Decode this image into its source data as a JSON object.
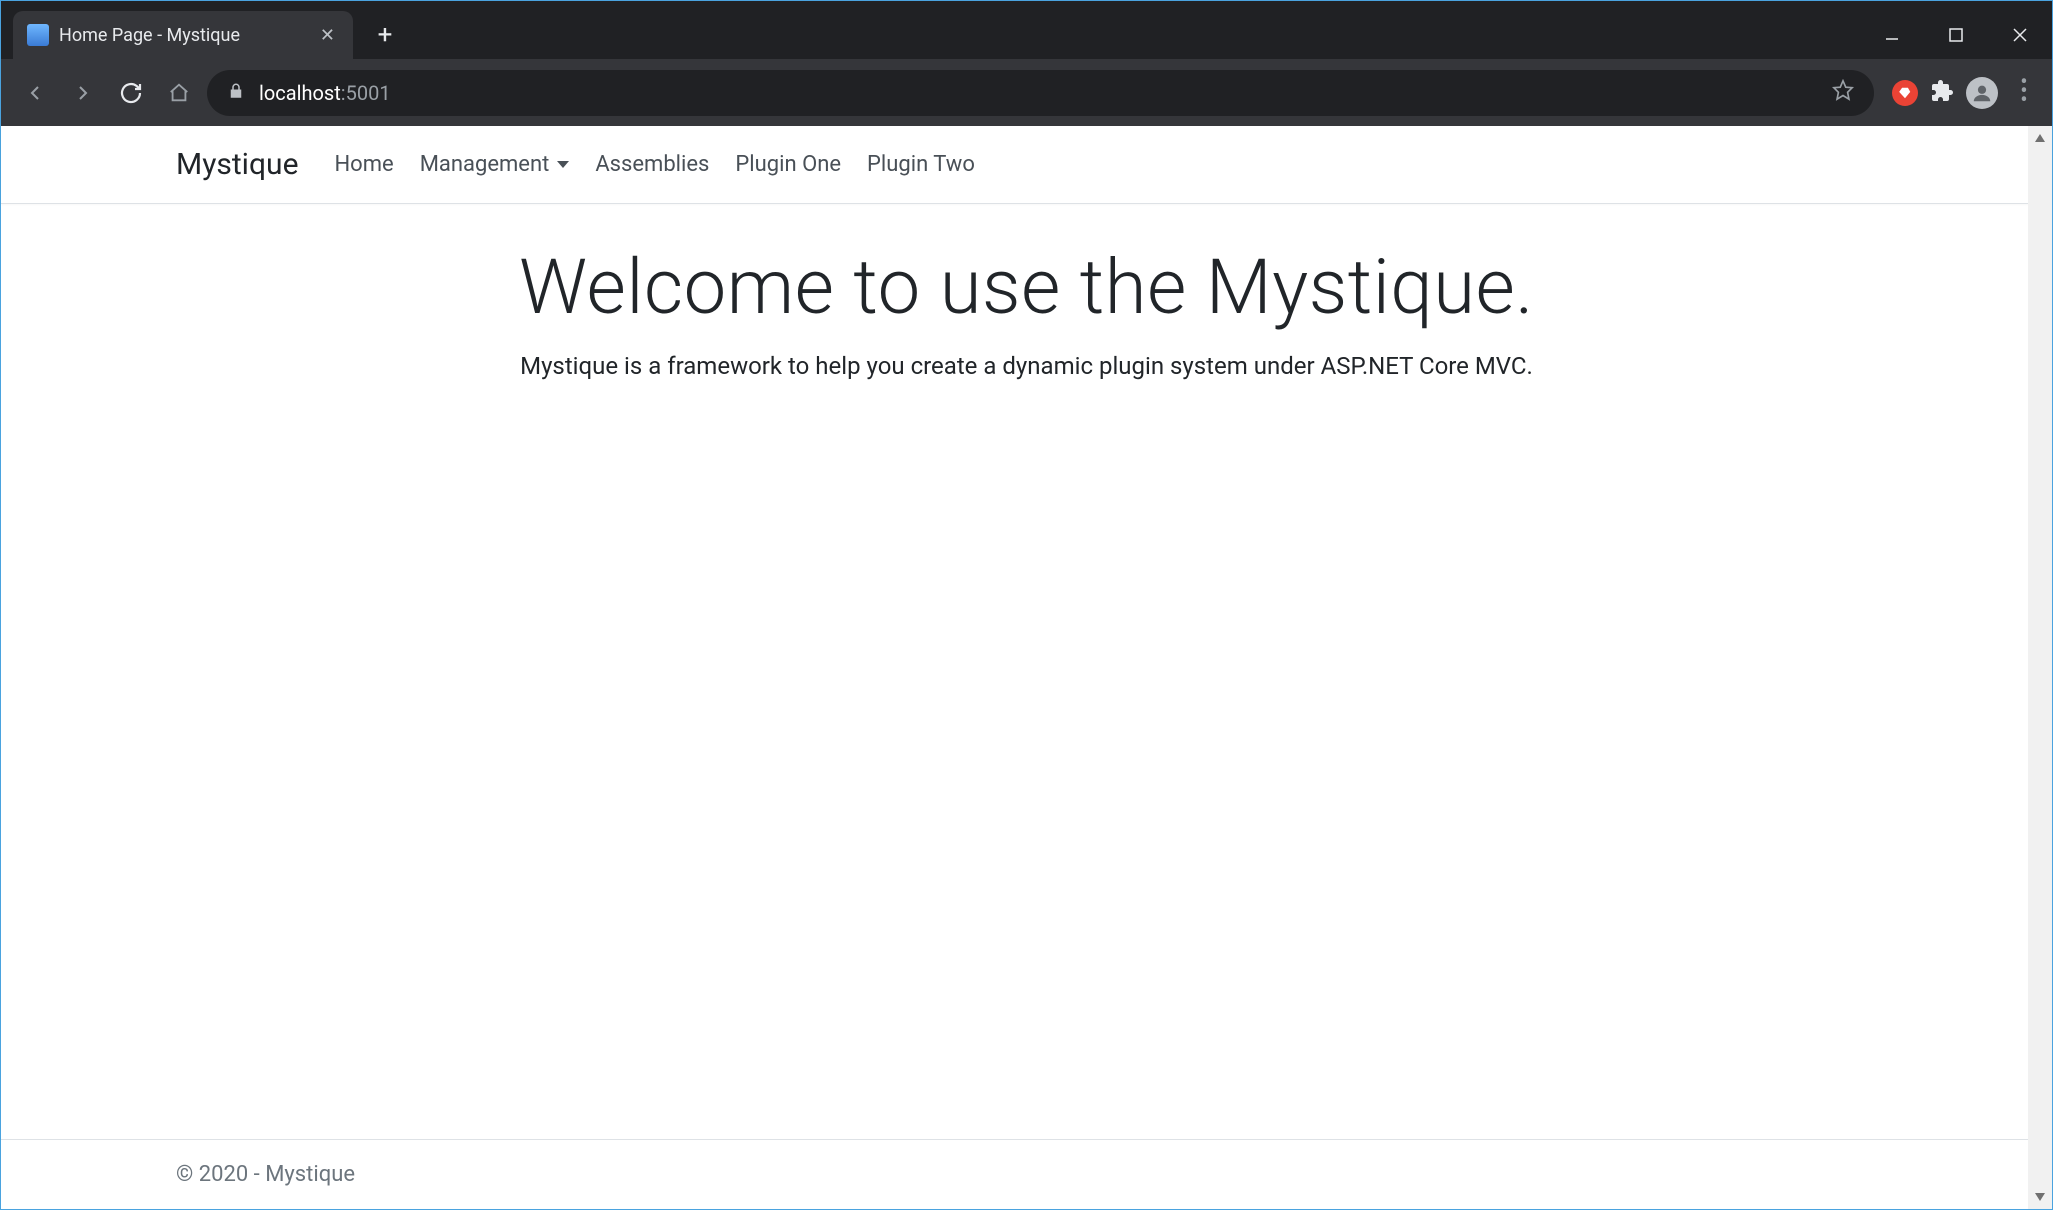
{
  "browser": {
    "tab_title": "Home Page - Mystique",
    "url_host": "localhost",
    "url_port": ":5001"
  },
  "nav": {
    "brand": "Mystique",
    "items": [
      {
        "label": "Home"
      },
      {
        "label": "Management",
        "dropdown": true
      },
      {
        "label": "Assemblies"
      },
      {
        "label": "Plugin One"
      },
      {
        "label": "Plugin Two"
      }
    ]
  },
  "hero": {
    "title": "Welcome to use the Mystique.",
    "subtitle": "Mystique is a framework to help you create a dynamic plugin system under ASP.NET Core MVC."
  },
  "footer": {
    "text": "© 2020 - Mystique"
  }
}
